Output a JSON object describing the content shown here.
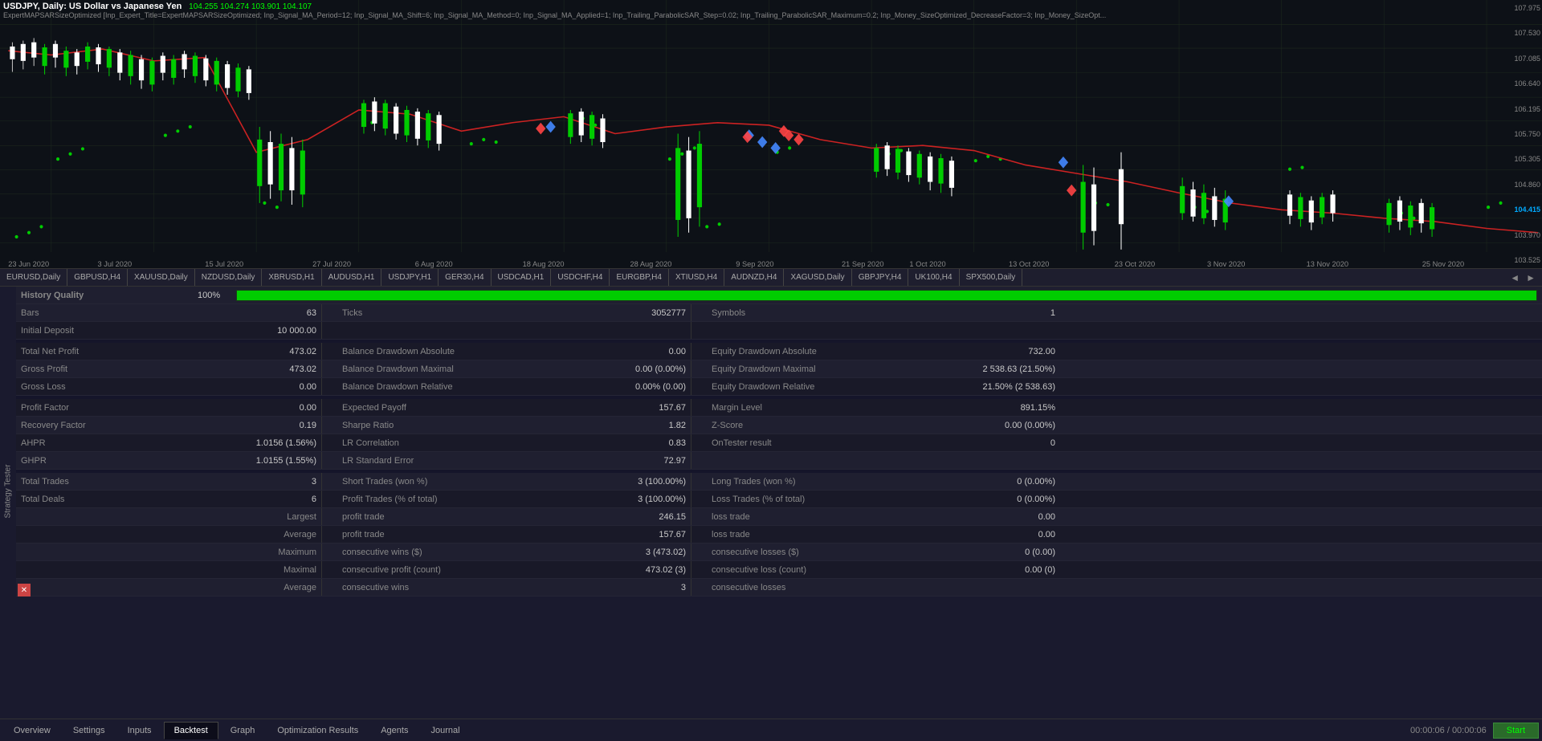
{
  "chart": {
    "title": "USDJPY, Daily: US Dollar vs Japanese Yen",
    "values": "104.255  104.274  103.901  104.107",
    "subtitle": "ExpertMAPSARSizeOptimized [Inp_Expert_Title=ExpertMAPSARSizeOptimized; Inp_Signal_MA_Period=12; Inp_Signal_MA_Shift=6; Inp_Signal_MA_Method=0; Inp_Signal_MA_Applied=1; Inp_Trailing_ParabolicSAR_Step=0.02; Inp_Trailing_ParabolicSAR_Maximum=0.2; Inp_Money_SizeOptimized_DecreaseFactor=3; Inp_Money_SizeOpt...",
    "price_levels": [
      "107.975",
      "107.530",
      "107.085",
      "106.640",
      "106.195",
      "105.750",
      "105.305",
      "104.860",
      "104.415",
      "103.970",
      "103.525"
    ],
    "dates": [
      "23 Jun 2020",
      "3 Jul 2020",
      "15 Jul 2020",
      "27 Jul 2020",
      "6 Aug 2020",
      "18 Aug 2020",
      "28 Aug 2020",
      "9 Sep 2020",
      "21 Sep 2020",
      "1 Oct 2020",
      "13 Oct 2020",
      "23 Oct 2020",
      "3 Nov 2020",
      "13 Nov 2020",
      "25 Nov 2020"
    ]
  },
  "chart_tabs": [
    "EURUSD,Daily",
    "GBPUSD,H4",
    "XAUUSD,Daily",
    "NZDUSD,Daily",
    "XBRUSD,H1",
    "AUDUSD,H1",
    "USDJPY,H1",
    "GER30,H4",
    "USDCAD,H1",
    "USDCHF,H4",
    "EURGBP,H4",
    "XTIUSD,H4",
    "AUDNZD,H4",
    "XAGUSD,Daily",
    "GBPJPY,H4",
    "UK100,H4",
    "SPX500,Daily"
  ],
  "results": {
    "history_quality": {
      "label": "History Quality",
      "value": "100%",
      "progress": 100
    },
    "rows": [
      {
        "col1_label": "Bars",
        "col1_value": "63",
        "col2_label": "Ticks",
        "col2_value": "3052777",
        "col3_label": "Symbols",
        "col3_value": "1"
      },
      {
        "col1_label": "Initial Deposit",
        "col1_value": "10 000.00",
        "col2_label": "",
        "col2_value": "",
        "col3_label": "",
        "col3_value": ""
      }
    ],
    "metrics": [
      {
        "label1": "Total Net Profit",
        "val1": "473.02",
        "label2": "Balance Drawdown Absolute",
        "val2": "0.00",
        "label3": "Equity Drawdown Absolute",
        "val3": "732.00"
      },
      {
        "label1": "Gross Profit",
        "val1": "473.02",
        "label2": "Balance Drawdown Maximal",
        "val2": "0.00 (0.00%)",
        "label3": "Equity Drawdown Maximal",
        "val3": "2 538.63 (21.50%)"
      },
      {
        "label1": "Gross Loss",
        "val1": "0.00",
        "label2": "Balance Drawdown Relative",
        "val2": "0.00% (0.00)",
        "label3": "Equity Drawdown Relative",
        "val3": "21.50% (2 538.63)"
      }
    ],
    "metrics2": [
      {
        "label1": "Profit Factor",
        "val1": "0.00",
        "label2": "Expected Payoff",
        "val2": "157.67",
        "label3": "Margin Level",
        "val3": "891.15%"
      },
      {
        "label1": "Recovery Factor",
        "val1": "0.19",
        "label2": "Sharpe Ratio",
        "val2": "1.82",
        "label3": "Z-Score",
        "val3": "0.00 (0.00%)"
      },
      {
        "label1": "AHPR",
        "val1": "1.0156 (1.56%)",
        "label2": "LR Correlation",
        "val2": "0.83",
        "label3": "OnTester result",
        "val3": "0"
      },
      {
        "label1": "GHPR",
        "val1": "1.0155 (1.55%)",
        "label2": "LR Standard Error",
        "val2": "72.97",
        "label3": "",
        "val3": ""
      }
    ],
    "trades": [
      {
        "label1": "Total Trades",
        "val1": "3",
        "label2": "Short Trades (won %)",
        "val2": "3 (100.00%)",
        "label3": "Long Trades (won %)",
        "val3": "0 (0.00%)"
      },
      {
        "label1": "Total Deals",
        "val1": "6",
        "label2": "Profit Trades (% of total)",
        "val2": "3 (100.00%)",
        "label3": "Loss Trades (% of total)",
        "val3": "0 (0.00%)"
      },
      {
        "label1": "",
        "val1": "Largest",
        "label2": "profit trade",
        "val2": "246.15",
        "label3": "loss trade",
        "val3": "0.00"
      },
      {
        "label1": "",
        "val1": "Average",
        "label2": "profit trade",
        "val2": "157.67",
        "label3": "loss trade",
        "val3": "0.00"
      },
      {
        "label1": "",
        "val1": "Maximum",
        "label2": "consecutive wins ($)",
        "val2": "3 (473.02)",
        "label3": "consecutive losses ($)",
        "val3": "0 (0.00)"
      },
      {
        "label1": "",
        "val1": "Maximal",
        "label2": "consecutive profit (count)",
        "val2": "473.02 (3)",
        "label3": "consecutive loss (count)",
        "val3": "0.00 (0)"
      },
      {
        "label1": "",
        "val1": "Average",
        "label2": "consecutive wins",
        "val2": "3",
        "label3": "consecutive losses",
        "val3": ""
      }
    ]
  },
  "bottom_tabs": {
    "tabs": [
      "Overview",
      "Settings",
      "Inputs",
      "Backtest",
      "Graph",
      "Optimization Results",
      "Agents",
      "Journal"
    ],
    "active": "Backtest",
    "timer": "00:00:06 / 00:00:06",
    "start_label": "Start"
  },
  "sidebar_label": "Strategy Tester"
}
